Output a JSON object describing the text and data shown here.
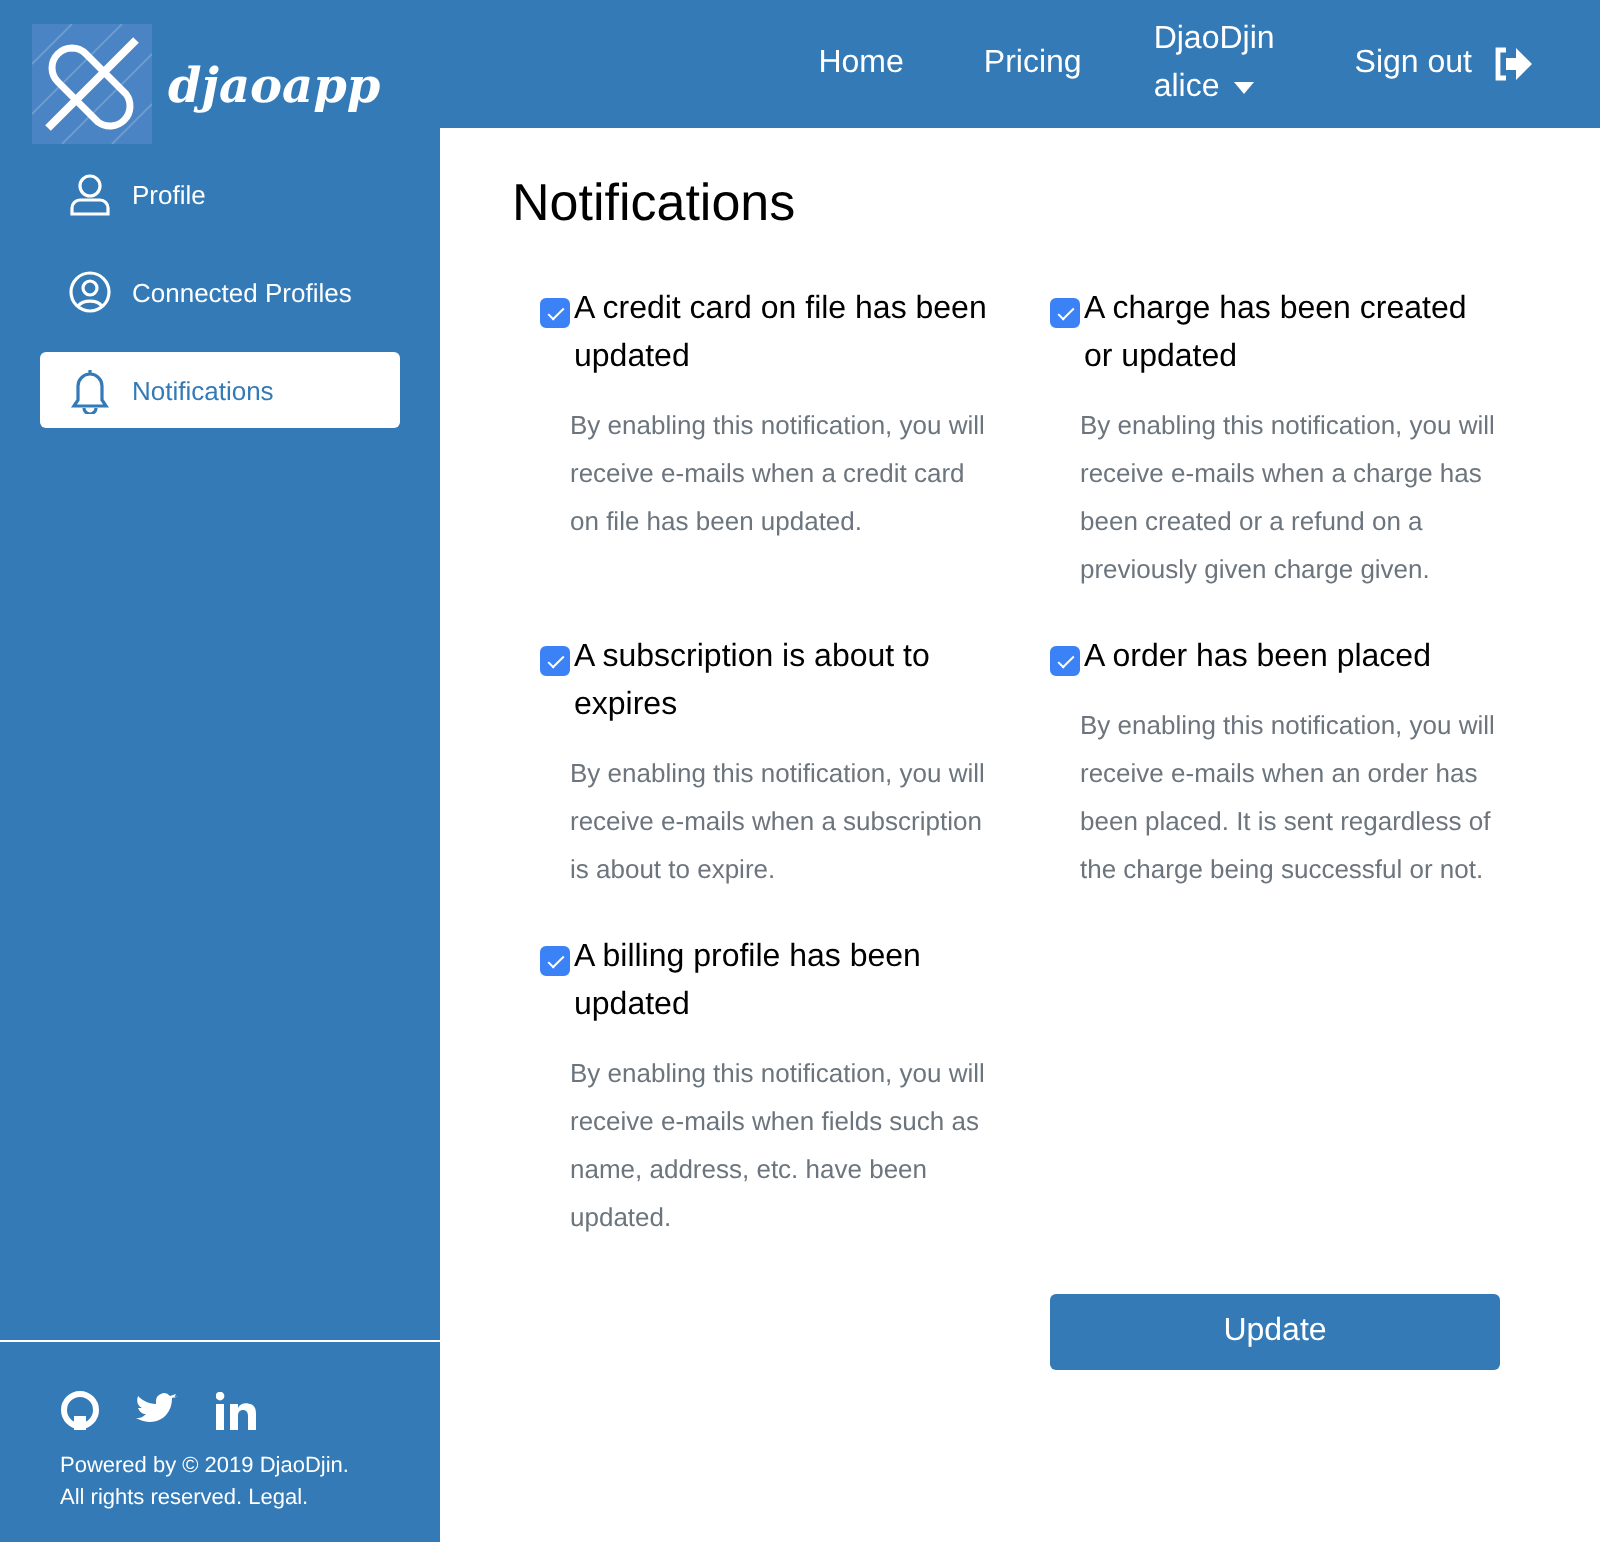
{
  "header": {
    "logo_text": "djaoapp",
    "nav": [
      {
        "label": "Home",
        "kind": "link"
      },
      {
        "label": "Pricing",
        "kind": "link"
      },
      {
        "label": "DjaoDjin",
        "sublabel": "alice",
        "kind": "dropdown"
      },
      {
        "label": "Sign out",
        "kind": "signout"
      }
    ]
  },
  "sidebar": {
    "items": [
      {
        "label": "Profile",
        "selected": false
      },
      {
        "label": "Connected Profiles",
        "selected": false
      },
      {
        "label": "Notifications",
        "selected": true
      }
    ],
    "footer": {
      "text": [
        "Powered by © 2019 DjaoDjin.",
        "All rights reserved. Legal."
      ]
    }
  },
  "main": {
    "title": "Notifications",
    "notifications": [
      {
        "title": "A credit card on file has been updated",
        "checked": true,
        "description": "By enabling this notification, you will receive e-mails when a credit card on file has been updated."
      },
      {
        "title": "A charge has been created or updated",
        "checked": true,
        "description": "By enabling this notification, you will receive e-mails when a charge has been created or a refund on a previously given charge given."
      },
      {
        "title": "A subscription is about to expires",
        "checked": true,
        "description": "By enabling this notification, you will receive e-mails when a subscription is about to expire."
      },
      {
        "title": "A order has been placed",
        "checked": true,
        "description": "By enabling this notification, you will receive e-mails when an order has been placed. It is sent regardless of the charge being successful or not."
      },
      {
        "title": "A billing profile has been updated",
        "checked": true,
        "description": "By enabling this notification, you will receive e-mails when fields such as name, address, etc. have been updated."
      }
    ],
    "button": "Update"
  }
}
